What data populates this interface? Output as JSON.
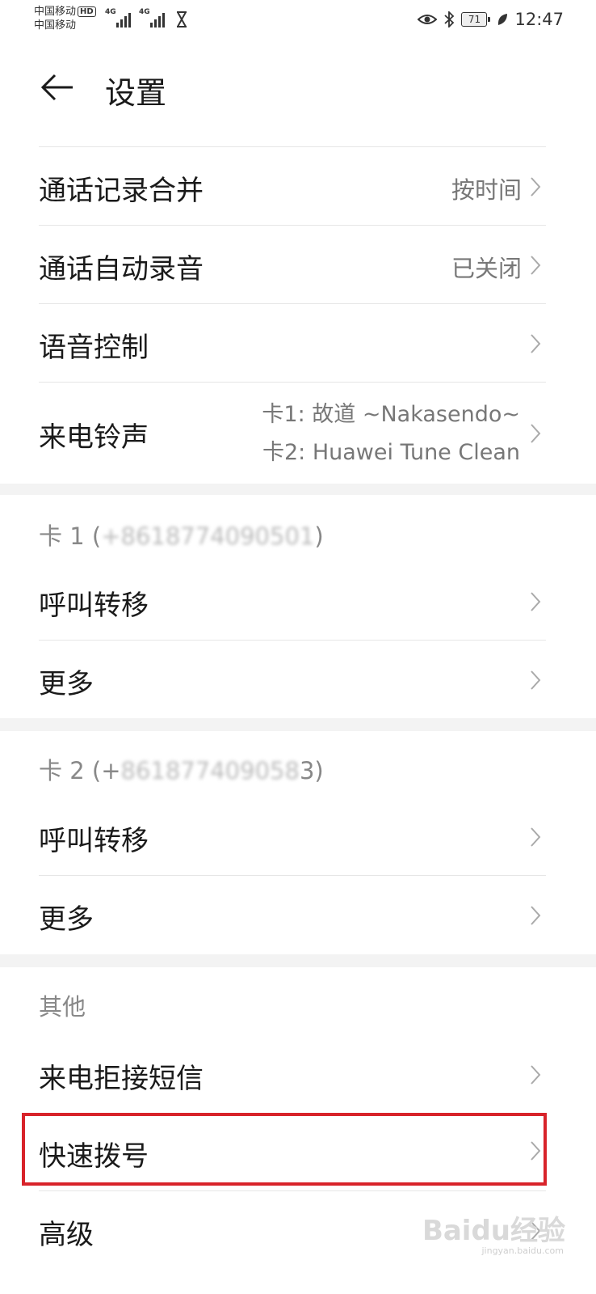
{
  "status": {
    "carrier1": "中国移动",
    "carrier1_badge": "HD",
    "carrier2": "中国移动",
    "signal1": "4G",
    "signal2": "4G",
    "battery": "71",
    "time": "12:47"
  },
  "header": {
    "title": "设置"
  },
  "group1": [
    {
      "label": "通话记录合并",
      "value": "按时间"
    },
    {
      "label": "通话自动录音",
      "value": "已关闭"
    },
    {
      "label": "语音控制",
      "value": ""
    },
    {
      "label": "来电铃声",
      "value_line1": "卡1: 故道 ~Nakasendo~",
      "value_line2": "卡2: Huawei Tune Clean"
    }
  ],
  "card1": {
    "header_prefix": "卡 1 (",
    "header_masked": "+8618774090501",
    "header_suffix": ")",
    "items": [
      {
        "label": "呼叫转移"
      },
      {
        "label": "更多"
      }
    ]
  },
  "card2": {
    "header_prefix": "卡 2 (+",
    "header_masked": "861877409058",
    "header_suffix": "3)",
    "items": [
      {
        "label": "呼叫转移"
      },
      {
        "label": "更多"
      }
    ]
  },
  "other": {
    "header": "其他",
    "items": [
      {
        "label": "来电拒接短信"
      },
      {
        "label": "快速拨号"
      },
      {
        "label": "高级"
      }
    ]
  },
  "watermark": {
    "text": "Baidu经验",
    "sub": "jingyan.baidu.com"
  },
  "colors": {
    "highlight": "#d8232a",
    "band": "#f3f3f3"
  }
}
